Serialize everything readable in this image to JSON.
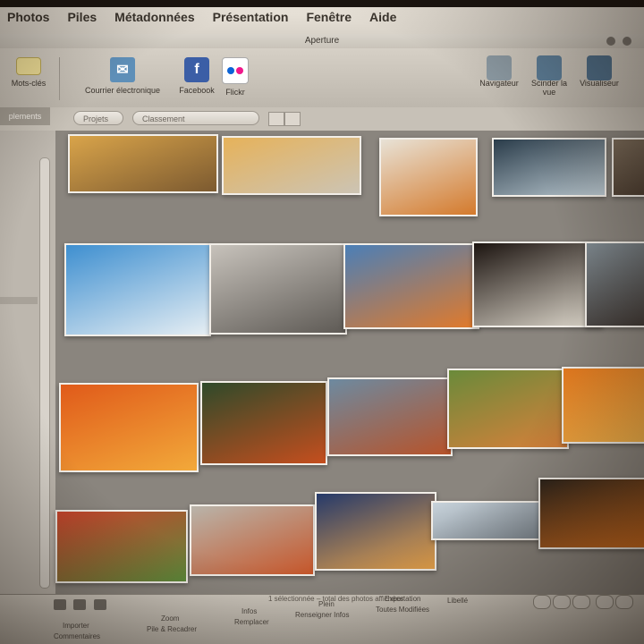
{
  "menu": {
    "items": [
      "Photos",
      "Piles",
      "Métadonnées",
      "Présentation",
      "Fenêtre",
      "Aide"
    ]
  },
  "window": {
    "title": "Aperture"
  },
  "toolbar": {
    "keywords_label": "Mots-clés",
    "email_label": "Courrier électronique",
    "facebook_label": "Facebook",
    "flickr_label": "Flickr",
    "navigator_label": "Navigateur",
    "split_label": "Scinder la vue",
    "viewer_label": "Visualiseur"
  },
  "strip": {
    "left_tab": "plements",
    "projects_button": "Projets",
    "sort_select": "Classement"
  },
  "photos": [
    {
      "name": "photo-autumn-park-path",
      "colors": [
        "#d9a44a",
        "#7c5a30"
      ]
    },
    {
      "name": "photo-ginkgo-avenue",
      "colors": [
        "#e6b25a",
        "#ccc4b4"
      ]
    },
    {
      "name": "photo-white-building-autumn",
      "colors": [
        "#e8e2d6",
        "#d47a2c"
      ]
    },
    {
      "name": "photo-glass-canopy",
      "colors": [
        "#2a3c4a",
        "#b9c7cf"
      ]
    },
    {
      "name": "photo-edge-crop",
      "colors": [
        "#7a6b5a",
        "#4a3c30"
      ]
    },
    {
      "name": "photo-tower-looking-up",
      "colors": [
        "#3e8fd0",
        "#e6eef3"
      ]
    },
    {
      "name": "photo-pillars-couple",
      "colors": [
        "#c7c2bb",
        "#5e5a55"
      ]
    },
    {
      "name": "photo-station-train",
      "colors": [
        "#4b7fb7",
        "#e27a2a"
      ]
    },
    {
      "name": "photo-osaka-castle",
      "colors": [
        "#1c1410",
        "#ded8cc"
      ]
    },
    {
      "name": "photo-castle-edge",
      "colors": [
        "#7f8a91",
        "#3d3632"
      ]
    },
    {
      "name": "photo-red-maple",
      "colors": [
        "#e05a1a",
        "#f2a93a"
      ]
    },
    {
      "name": "photo-garden-pond",
      "colors": [
        "#2f4a2a",
        "#c54e1e"
      ]
    },
    {
      "name": "photo-pond-reflection",
      "colors": [
        "#6d8aa0",
        "#b7532a"
      ]
    },
    {
      "name": "photo-garden-trees",
      "colors": [
        "#6a8a3a",
        "#d8803a"
      ]
    },
    {
      "name": "photo-orange-foliage",
      "colors": [
        "#e2781e",
        "#f3b34a"
      ]
    },
    {
      "name": "photo-red-garden",
      "colors": [
        "#c7432c",
        "#5c8a3a"
      ]
    },
    {
      "name": "photo-city-aerial",
      "colors": [
        "#b9b4aa",
        "#c6562a"
      ]
    },
    {
      "name": "photo-sunset-sky",
      "colors": [
        "#263a6a",
        "#e7a24a"
      ]
    },
    {
      "name": "photo-panorama",
      "colors": [
        "#c8d3db",
        "#7d8790"
      ]
    },
    {
      "name": "photo-dark-autumn",
      "colors": [
        "#2a221a",
        "#d8701e"
      ]
    }
  ],
  "bottom": {
    "status": "1 sélectionnée – total des photos affichées",
    "labels": [
      "Importer",
      "Commentaires",
      "Zoom",
      "Pile & Recadrer",
      "Infos",
      "Remplacer",
      "Plein",
      "Renseigner Infos",
      "Exportation",
      "Toutes Modifiées",
      "Libellé"
    ]
  }
}
